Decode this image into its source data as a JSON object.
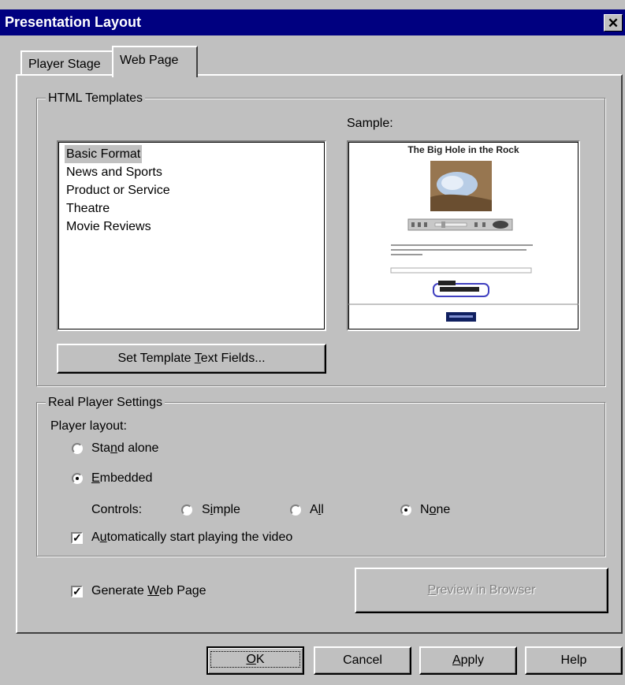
{
  "window": {
    "title": "Presentation Layout",
    "close_glyph": "✕"
  },
  "tabs": [
    {
      "label": "Player Stage",
      "active": false
    },
    {
      "label": "Web Page",
      "active": true
    }
  ],
  "html_templates": {
    "legend": "HTML Templates",
    "sample_label": "Sample:",
    "items": [
      "Basic Format",
      "News and Sports",
      "Product or Service",
      "Theatre",
      "Movie Reviews"
    ],
    "selected_index": 0,
    "set_fields_button": {
      "pre": "Set Template ",
      "mnemonic": "T",
      "post": "ext Fields..."
    }
  },
  "sample_preview": {
    "title": "The Big Hole in the Rock"
  },
  "real_player": {
    "legend": "Real Player Settings",
    "layout_label": "Player layout:",
    "stand_alone": {
      "pre": "Sta",
      "mnemonic": "n",
      "post": "d alone",
      "checked": false
    },
    "embedded": {
      "pre": "",
      "mnemonic": "E",
      "post": "mbedded",
      "checked": true
    },
    "controls_label": "Controls:",
    "controls": [
      {
        "pre": "S",
        "mnemonic": "i",
        "post": "mple",
        "checked": false
      },
      {
        "pre": "A",
        "mnemonic": "l",
        "post": "l",
        "checked": false
      },
      {
        "pre": "N",
        "mnemonic": "o",
        "post": "ne",
        "checked": true
      }
    ],
    "autostart": {
      "pre": "A",
      "mnemonic": "u",
      "post": "tomatically start playing the video",
      "checked": true
    }
  },
  "generate_web_page": {
    "pre": "Generate ",
    "mnemonic": "W",
    "post": "eb Page",
    "checked": true
  },
  "preview_button": {
    "pre": "",
    "mnemonic": "P",
    "post": "review in Browser",
    "enabled": false
  },
  "footer_buttons": {
    "ok": {
      "pre": "",
      "mnemonic": "O",
      "post": "K"
    },
    "cancel": "Cancel",
    "apply": {
      "pre": "",
      "mnemonic": "A",
      "post": "pply"
    },
    "help": "Help"
  }
}
